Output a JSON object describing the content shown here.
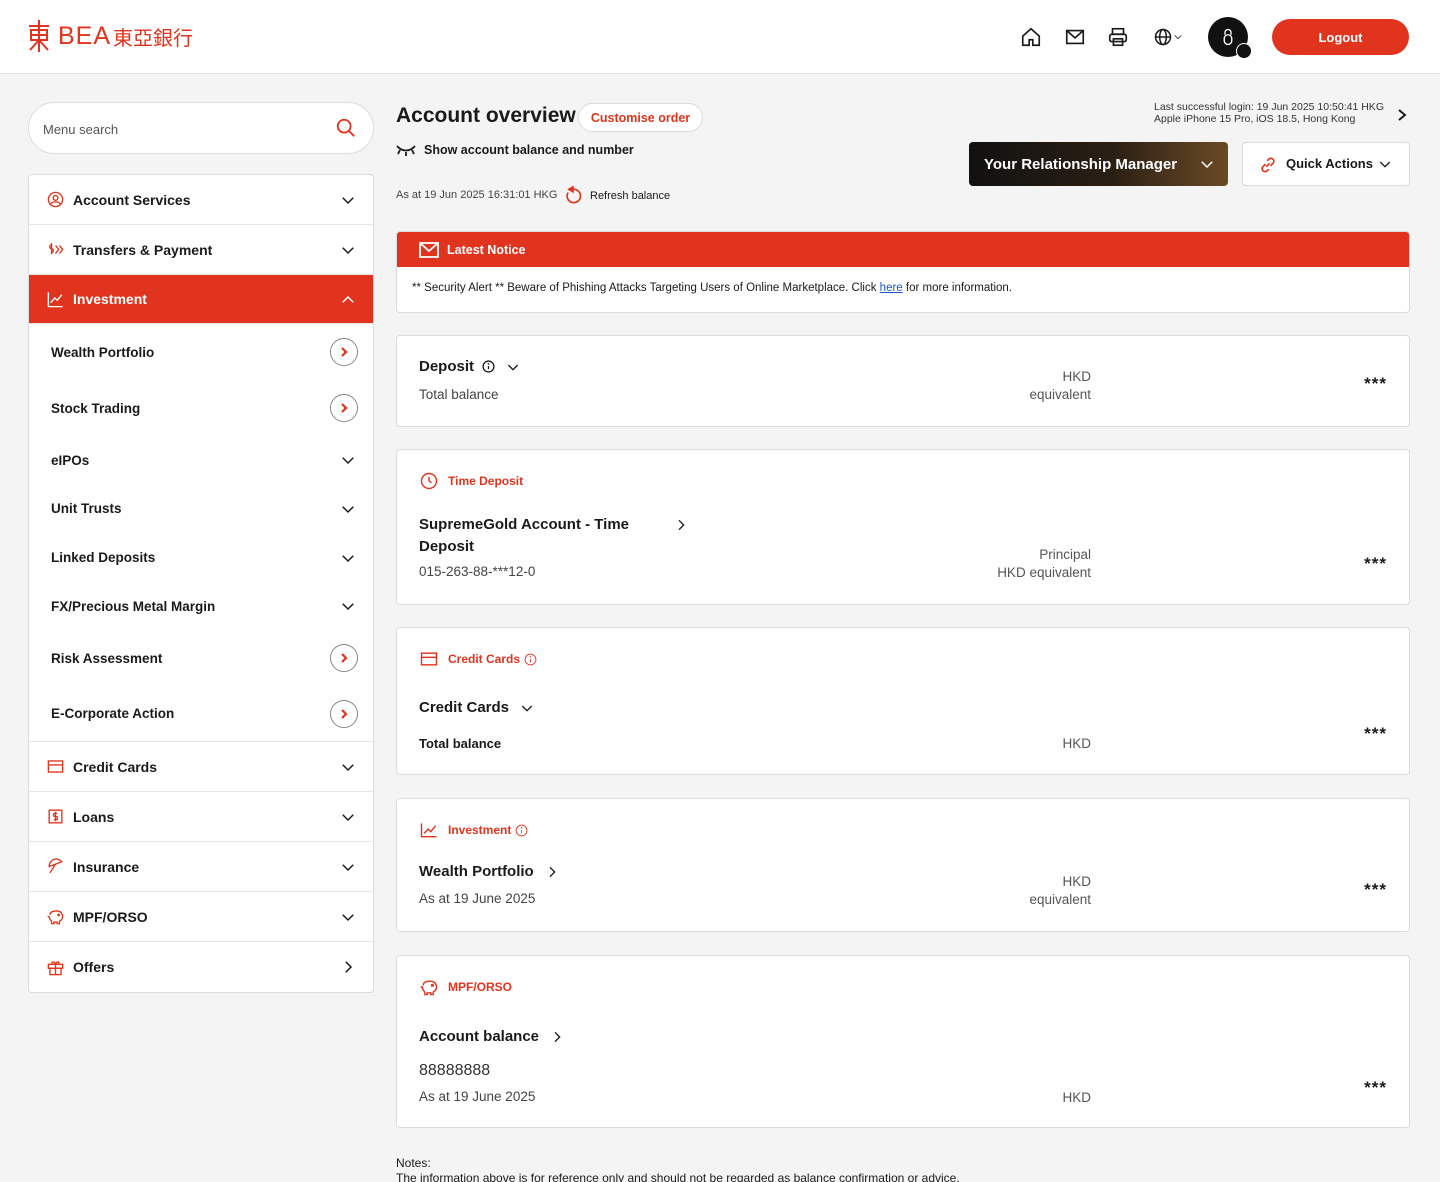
{
  "header": {
    "logo_text": "BEA",
    "logo_cn": "東亞銀行",
    "logout_label": "Logout",
    "icons": [
      "home-icon",
      "mail-icon",
      "printer-icon",
      "globe-icon",
      "user-icon"
    ]
  },
  "sidebar": {
    "search_placeholder": "Menu search",
    "items": [
      {
        "label": "Account Services",
        "icon": "user-circle-icon"
      },
      {
        "label": "Transfers & Payment",
        "icon": "transfer-icon"
      },
      {
        "label": "Investment",
        "icon": "chart-line-icon",
        "expanded": true
      },
      {
        "label": "Credit Cards",
        "icon": "credit-card-icon"
      },
      {
        "label": "Loans",
        "icon": "dollar-box-icon"
      },
      {
        "label": "Insurance",
        "icon": "umbrella-icon"
      },
      {
        "label": "MPF/ORSO",
        "icon": "piggy-bank-icon"
      },
      {
        "label": "Offers",
        "icon": "gift-icon"
      }
    ],
    "investment_sub": [
      {
        "label": "Wealth Portfolio",
        "type": "link"
      },
      {
        "label": "Stock Trading",
        "type": "link"
      },
      {
        "label": "eIPOs",
        "type": "expand"
      },
      {
        "label": "Unit Trusts",
        "type": "expand"
      },
      {
        "label": "Linked Deposits",
        "type": "expand"
      },
      {
        "label": "FX/Precious Metal Margin",
        "type": "expand"
      },
      {
        "label": "Risk Assessment",
        "type": "link"
      },
      {
        "label": "E-Corporate Action",
        "type": "link"
      }
    ]
  },
  "main": {
    "title": "Account overview",
    "customise_label": "Customise order",
    "show_balance_label": "Show account balance and number",
    "as_at": "As at 19 Jun 2025 16:31:01 HKG",
    "refresh_label": "Refresh balance",
    "last_login_line1": "Last successful login: 19 Jun 2025 10:50:41 HKG",
    "last_login_line2": "Apple iPhone 15 Pro, iOS 18.5, Hong Kong",
    "rm_label": "Your Relationship Manager",
    "quick_actions_label": "Quick Actions",
    "notice": {
      "title": "Latest Notice",
      "text_before": "** Security Alert ** Beware of Phishing Attacks Targeting Users of Online Marketplace. Click ",
      "link": "here",
      "text_after": " for more information."
    },
    "deposit": {
      "title": "Deposit",
      "subtitle": "Total balance",
      "currency_line1": "HKD",
      "currency_line2": "equivalent",
      "masked": "***"
    },
    "time_deposit": {
      "section": "Time Deposit",
      "title_line1": "SupremeGold Account - Time",
      "title_line2": "Deposit",
      "account": "015-263-88-***12-0",
      "currency_line1": "Principal",
      "currency_line2": "HKD equivalent",
      "masked": "***"
    },
    "credit_cards": {
      "section": "Credit Cards",
      "title": "Credit Cards",
      "subtitle": "Total balance",
      "currency": "HKD",
      "masked": "***"
    },
    "investment": {
      "section": "Investment",
      "title": "Wealth Portfolio",
      "subtitle": "As at 19 June 2025",
      "currency_line1": "HKD",
      "currency_line2": "equivalent",
      "masked": "***"
    },
    "mpf": {
      "section": "MPF/ORSO",
      "title": "Account balance",
      "account": "88888888",
      "subtitle": "As at 19 June 2025",
      "currency": "HKD",
      "masked": "***"
    },
    "notes_title": "Notes:",
    "notes_text": "The information above is for reference only and should not be regarded as balance confirmation or advice."
  }
}
